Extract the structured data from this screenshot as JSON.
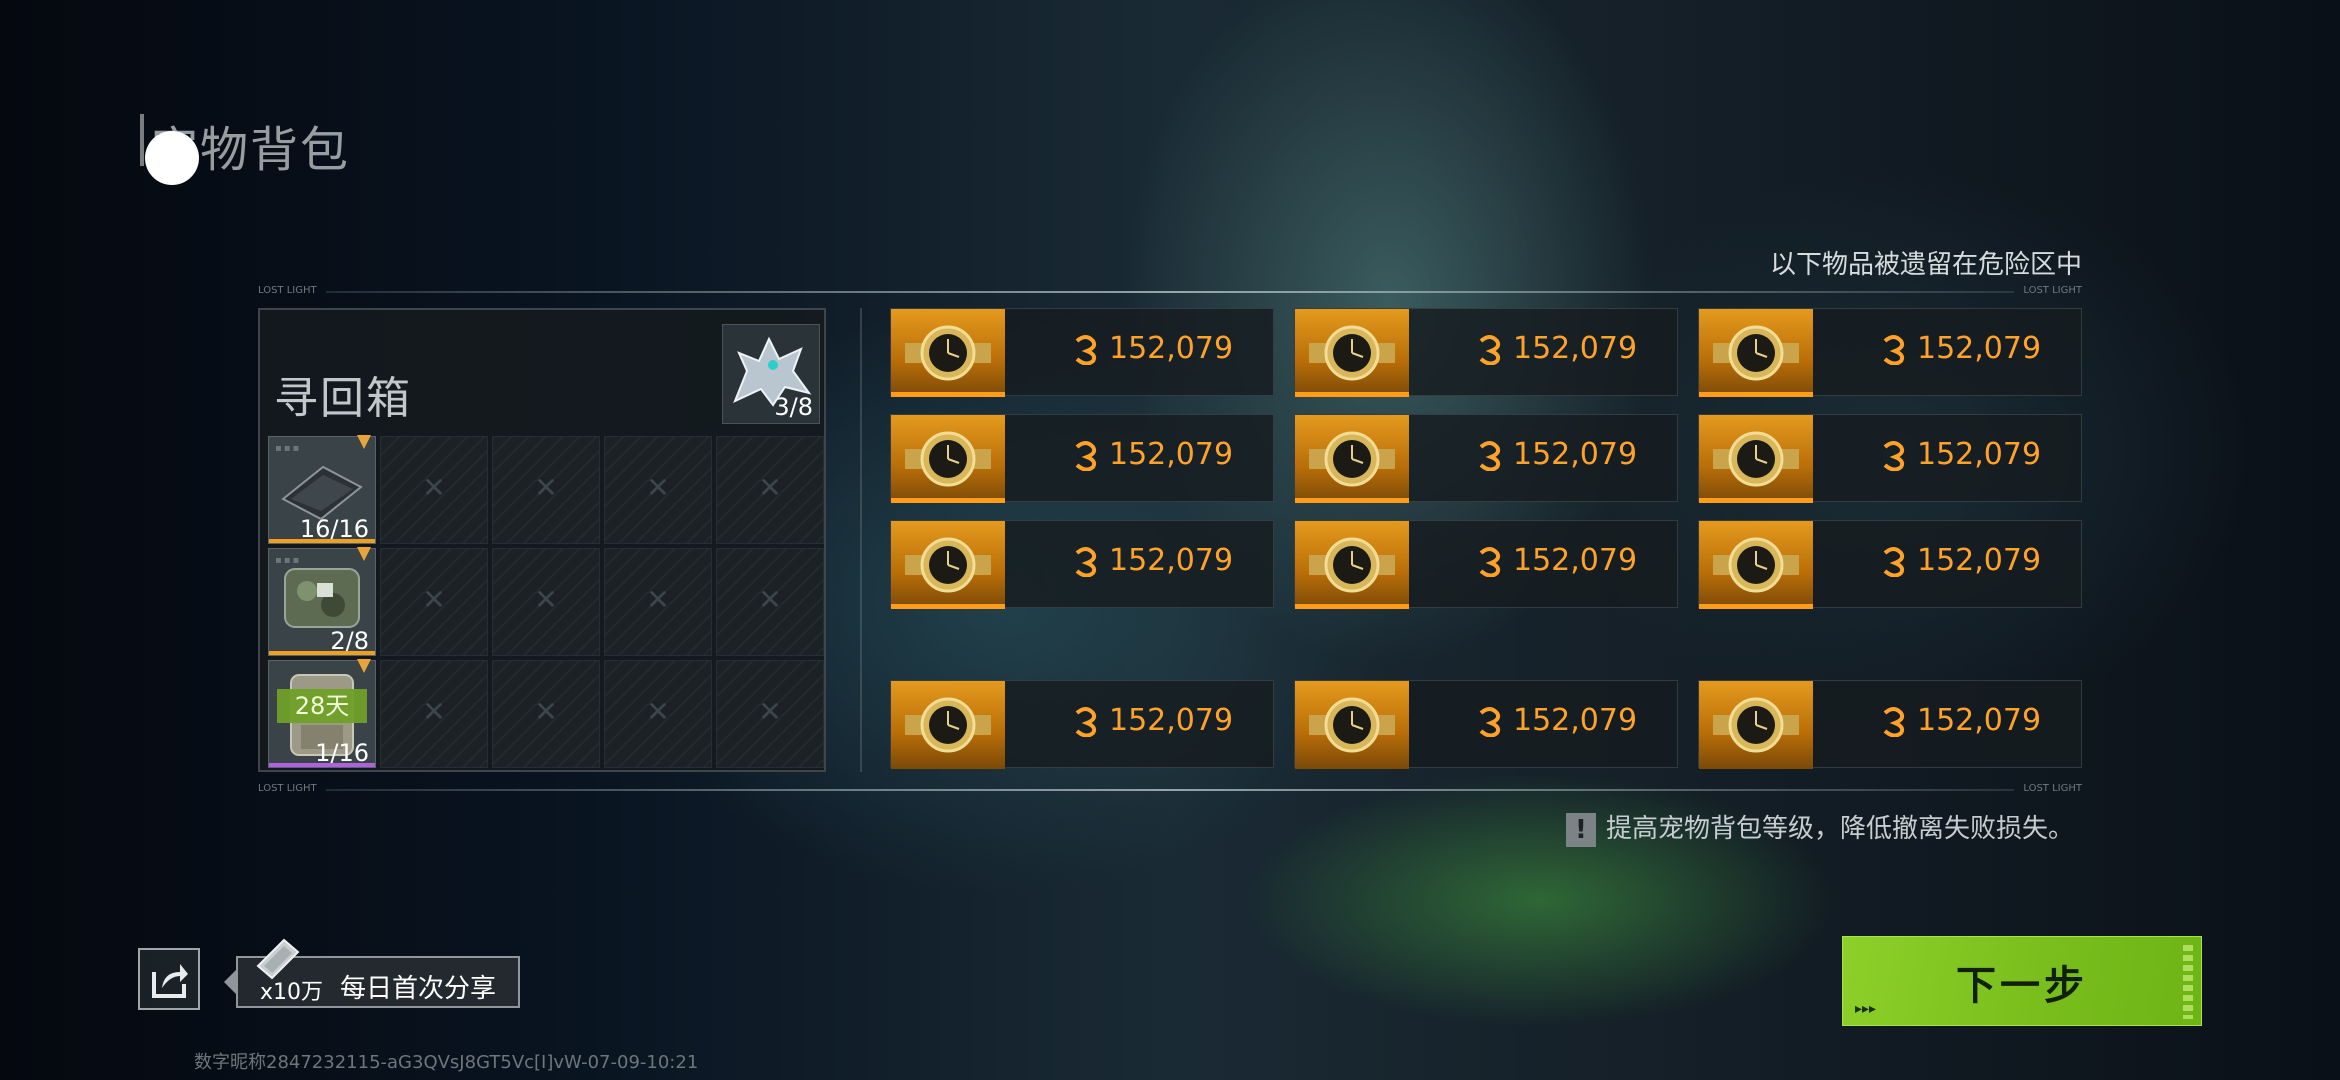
{
  "header": {
    "title": "宠物背包"
  },
  "lost_notice": "以下物品被遗留在危险区中",
  "frame": {
    "corner_label": "LOST LIGHT"
  },
  "recovery_box": {
    "title": "寻回箱",
    "pet_slot": {
      "icon": "dragon-pet-icon",
      "count": "3/8"
    },
    "rows": [
      {
        "icon": "pouch-icon",
        "qty": "16/16",
        "underline_color": "#f0a020",
        "days": ""
      },
      {
        "icon": "camo-bag-icon",
        "qty": "2/8",
        "underline_color": "#f0a020",
        "days": ""
      },
      {
        "icon": "backpack-icon",
        "qty": "1/16",
        "underline_color": "#b060e0",
        "days": "28天"
      }
    ],
    "empty_slot_glyph": "✕"
  },
  "lost_items": [
    {
      "icon": "gold-watch-icon",
      "value": "152,079"
    },
    {
      "icon": "gold-watch-icon",
      "value": "152,079"
    },
    {
      "icon": "gold-watch-icon",
      "value": "152,079"
    },
    {
      "icon": "gold-watch-icon",
      "value": "152,079"
    },
    {
      "icon": "gold-watch-icon",
      "value": "152,079"
    },
    {
      "icon": "gold-watch-icon",
      "value": "152,079"
    },
    {
      "icon": "gold-watch-icon",
      "value": "152,079"
    },
    {
      "icon": "gold-watch-icon",
      "value": "152,079"
    },
    {
      "icon": "gold-watch-icon",
      "value": "152,079"
    },
    {
      "icon": "gold-watch-icon",
      "value": "152,079"
    },
    {
      "icon": "gold-watch-icon",
      "value": "152,079"
    },
    {
      "icon": "gold-watch-icon",
      "value": "152,079"
    }
  ],
  "tip": {
    "icon": "exclamation-icon",
    "mark": "!",
    "text": "提高宠物背包等级，降低撤离失败损失。"
  },
  "share": {
    "icon": "share-icon",
    "reward": "x10万",
    "label": "每日首次分享"
  },
  "next_button": {
    "label": "下一步",
    "arrows": "▸▸▸"
  },
  "watermark": "数字昵称2847232115-aG3QVsJ8GT5Vc[I]vW-07-09-10:21",
  "colors": {
    "accent_orange": "#ffa22a",
    "next_green": "#7dc21f"
  }
}
